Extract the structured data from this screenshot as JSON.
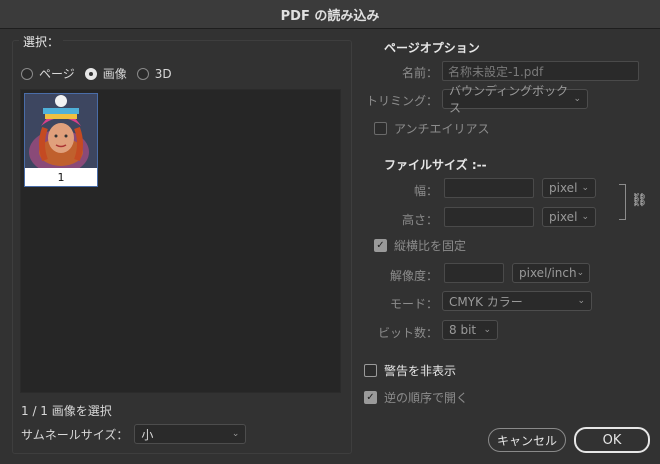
{
  "window": {
    "title": "PDF の読み込み"
  },
  "select": {
    "label": "選択：",
    "options": [
      {
        "label": "ページ",
        "selected": false
      },
      {
        "label": "画像",
        "selected": true
      },
      {
        "label": "3D",
        "selected": false
      }
    ],
    "thumbnails": [
      {
        "label": "1"
      }
    ],
    "status": "1 / 1 画像を選択",
    "thumb_size_label": "サムネールサイズ：",
    "thumb_size_value": "小"
  },
  "page_options": {
    "heading": "ページオプション",
    "name_label": "名前：",
    "name_value": "名称未設定-1.pdf",
    "crop_label": "トリミング：",
    "crop_value": "バウンディングボックス",
    "antialias_label": "アンチエイリアス"
  },
  "file_size": {
    "heading": "ファイルサイズ :--",
    "width_label": "幅：",
    "width_unit": "pixel",
    "height_label": "高さ：",
    "height_unit": "pixel",
    "constrain_label": "縦横比を固定",
    "resolution_label": "解像度：",
    "resolution_unit": "pixel/inch",
    "mode_label": "モード：",
    "mode_value": "CMYK カラー",
    "bitdepth_label": "ビット数：",
    "bitdepth_value": "8 bit"
  },
  "options": {
    "suppress_warnings": "警告を非表示",
    "reverse_order": "逆の順序で開く"
  },
  "buttons": {
    "cancel": "キャンセル",
    "ok": "OK"
  }
}
